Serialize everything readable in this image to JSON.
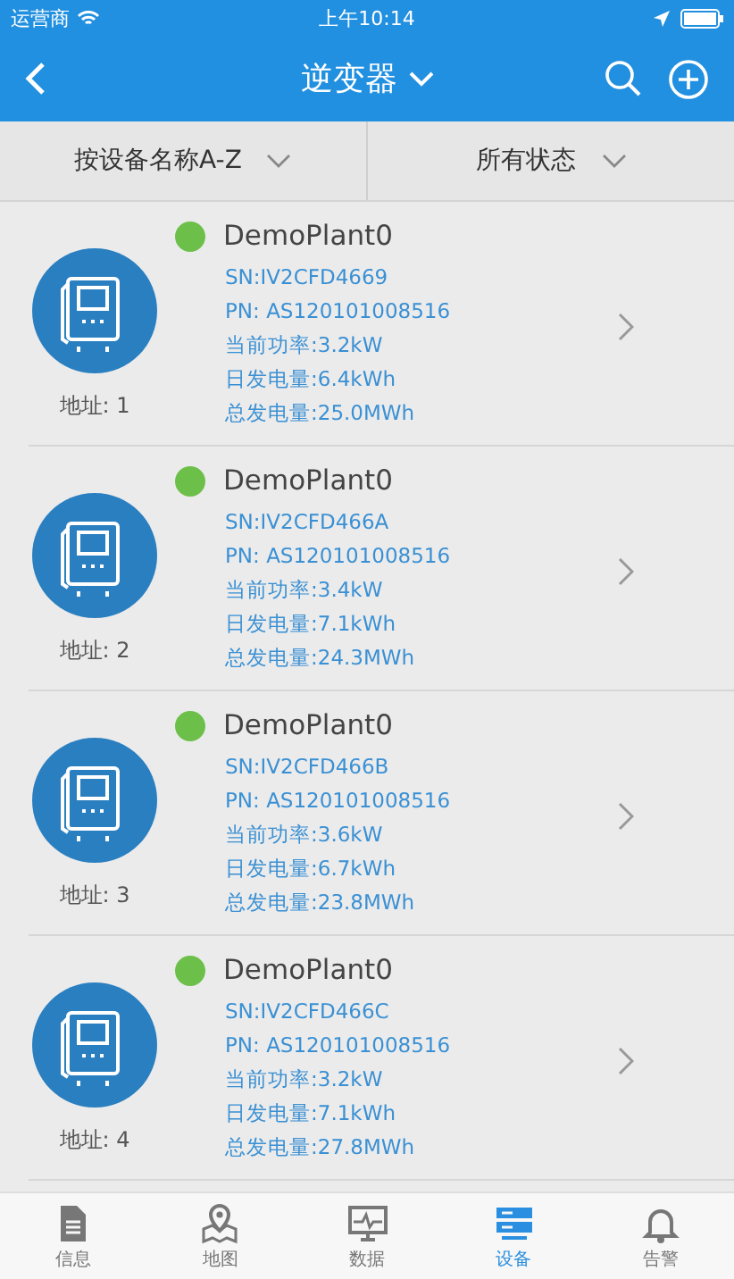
{
  "status_bar": {
    "carrier": "运营商",
    "time": "上午10:14"
  },
  "nav": {
    "title": "逆变器"
  },
  "filters": [
    {
      "label": "按设备名称A-Z"
    },
    {
      "label": "所有状态"
    }
  ],
  "devices": [
    {
      "name": "DemoPlant0",
      "color": "#6cc04a",
      "address": "地址: 1",
      "details": [
        "SN:IV2CFD4669",
        "PN: AS120101008516",
        "当前功率:3.2kW",
        "日发电量:6.4kWh",
        "总发电量:25.0MWh"
      ]
    },
    {
      "name": "DemoPlant0",
      "color": "#6cc04a",
      "address": "地址: 2",
      "details": [
        "SN:IV2CFD466A",
        "PN: AS120101008516",
        "当前功率:3.4kW",
        "日发电量:7.1kWh",
        "总发电量:24.3MWh"
      ]
    },
    {
      "name": "DemoPlant0",
      "color": "#6cc04a",
      "address": "地址: 3",
      "details": [
        "SN:IV2CFD466B",
        "PN: AS120101008516",
        "当前功率:3.6kW",
        "日发电量:6.7kWh",
        "总发电量:23.8MWh"
      ]
    },
    {
      "name": "DemoPlant0",
      "color": "#6cc04a",
      "address": "地址: 4",
      "details": [
        "SN:IV2CFD466C",
        "PN: AS120101008516",
        "当前功率:3.2kW",
        "日发电量:7.1kWh",
        "总发电量:27.8MWh"
      ]
    }
  ],
  "tabs": [
    {
      "label": "信息",
      "kind": "doc",
      "selected": false
    },
    {
      "label": "地图",
      "kind": "map",
      "selected": false
    },
    {
      "label": "数据",
      "kind": "monitor",
      "selected": false
    },
    {
      "label": "设备",
      "kind": "device",
      "selected": true
    },
    {
      "label": "告警",
      "kind": "bell",
      "selected": false
    }
  ]
}
